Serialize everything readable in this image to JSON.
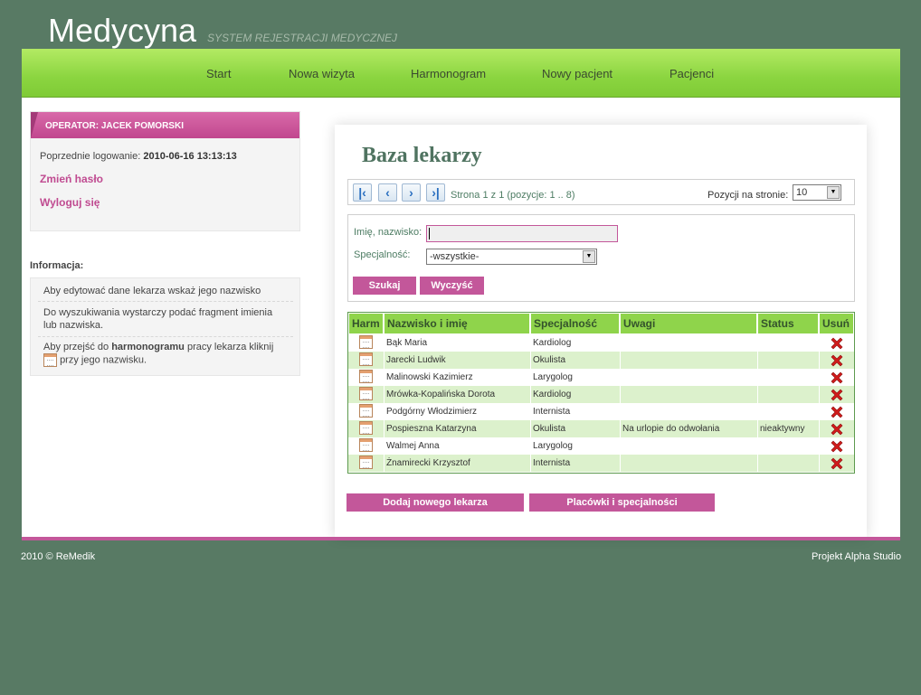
{
  "header": {
    "logo": "Medycyna",
    "tagline": "SYSTEM REJESTRACJI MEDYCZNEJ"
  },
  "nav": [
    {
      "label": "Start"
    },
    {
      "label": "Nowa wizyta"
    },
    {
      "label": "Harmonogram"
    },
    {
      "label": "Nowy pacjent"
    },
    {
      "label": "Pacjenci"
    }
  ],
  "operator": {
    "header": "OPERATOR: JACEK POMORSKI",
    "last_login_label": "Poprzednie logowanie:",
    "last_login_value": "2010-06-16 13:13:13",
    "change_password": "Zmień hasło",
    "logout": "Wyloguj się"
  },
  "info": {
    "title": "Informacja:",
    "item1": "Aby edytować dane lekarza wskaż jego nazwisko",
    "item2": "Do wyszukiwania wystarczy podać fragment imienia lub nazwiska.",
    "item3_pre": "Aby przejść do ",
    "item3_bold": "harmonogramu",
    "item3_post": " pracy lekarza kliknij",
    "item3_end": "przy jego nazwisku."
  },
  "main": {
    "title": "Baza lekarzy",
    "pager_info": "Strona 1 z 1 (pozycje: 1 .. 8)",
    "per_page_label": "Pozycji na stronie:",
    "per_page_value": "10"
  },
  "search": {
    "name_label": "Imię, nazwisko:",
    "name_value": "",
    "spec_label": "Specjalność:",
    "spec_value": "-wszystkie-",
    "search_button": "Szukaj",
    "clear_button": "Wyczyść"
  },
  "table": {
    "headers": [
      "Harm",
      "Nazwisko i imię",
      "Specjalność",
      "Uwagi",
      "Status",
      "Usuń"
    ],
    "rows": [
      {
        "name": "Bąk Maria",
        "spec": "Kardiolog",
        "notes": "",
        "status": ""
      },
      {
        "name": "Jarecki Ludwik",
        "spec": "Okulista",
        "notes": "",
        "status": ""
      },
      {
        "name": "Malinowski Kazimierz",
        "spec": "Larygolog",
        "notes": "",
        "status": ""
      },
      {
        "name": "Mrówka-Kopalińska Dorota",
        "spec": "Kardiolog",
        "notes": "",
        "status": ""
      },
      {
        "name": "Podgórny Włodzimierz",
        "spec": "Internista",
        "notes": "",
        "status": ""
      },
      {
        "name": "Pospieszna Katarzyna",
        "spec": "Okulista",
        "notes": "Na urlopie do odwołania",
        "status": "nieaktywny"
      },
      {
        "name": "Walmej Anna",
        "spec": "Larygolog",
        "notes": "",
        "status": ""
      },
      {
        "name": "Żnamirecki Krzysztof",
        "spec": "Internista",
        "notes": "",
        "status": ""
      }
    ]
  },
  "actions": {
    "add_doctor": "Dodaj nowego lekarza",
    "facilities": "Placówki i specjalności"
  },
  "footer": {
    "left": "2010 © ReMedik",
    "right": "Projekt Alpha Studio"
  },
  "colors": {
    "background": "#587a64",
    "accent_pink": "#c3579a",
    "nav_green": "#8bd540",
    "title_green": "#4f7360"
  },
  "icons": {
    "first": "first-page-icon",
    "prev": "prev-page-icon",
    "next": "next-page-icon",
    "last": "last-page-icon",
    "calendar": "calendar-icon",
    "delete": "delete-x-icon"
  }
}
